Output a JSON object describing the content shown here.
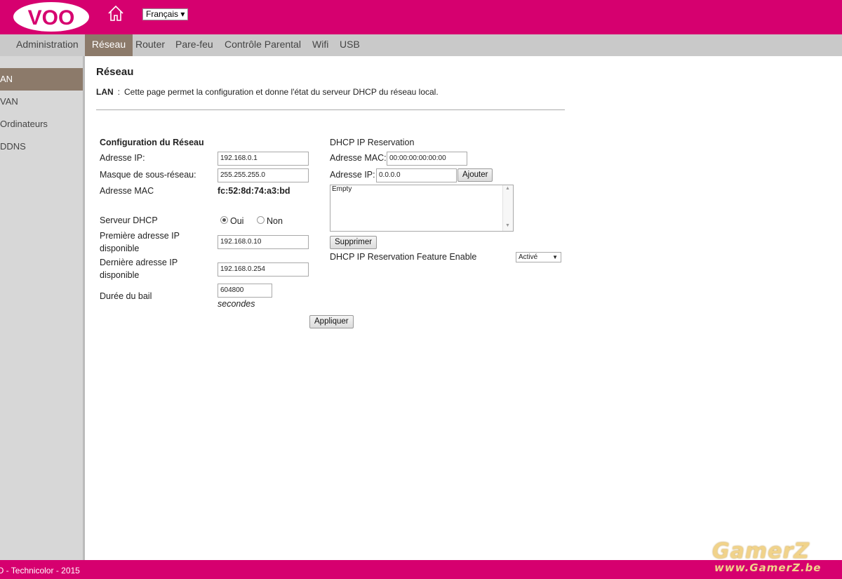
{
  "header": {
    "logo_text": "VOO",
    "home_icon": "home-icon",
    "language": "Français ▾"
  },
  "nav": {
    "items": [
      "Administration",
      "Réseau",
      "Router",
      "Pare-feu",
      "Contrôle Parental",
      "Wifi",
      "USB"
    ],
    "active": "Réseau"
  },
  "sidebar": {
    "items": [
      "LAN",
      "WAN",
      "Ordinateurs",
      "DDNS"
    ],
    "shown": [
      "AN",
      "VAN",
      "Ordinateurs",
      "DDNS"
    ],
    "active": "LAN"
  },
  "page": {
    "title": "Réseau",
    "desc_label": "LAN",
    "desc_sep": ":",
    "desc_text": "Cette page permet la configuration et donne l'état du serveur DHCP du réseau local."
  },
  "config": {
    "section_title": "Configuration du Réseau",
    "ip_label": "Adresse IP:",
    "ip_value": "192.168.0.1",
    "mask_label": "Masque de sous-réseau:",
    "mask_value": "255.255.255.0",
    "mac_label": "Adresse MAC",
    "mac_value": "fc:52:8d:74:a3:bd",
    "dhcp_label": "Serveur DHCP",
    "dhcp_oui": "Oui",
    "dhcp_non": "Non",
    "dhcp_selected": "Oui",
    "first_ip_label_1": "Première adresse IP",
    "first_ip_label_2": "disponible",
    "first_ip_value": "192.168.0.10",
    "last_ip_label_1": "Dernière adresse IP",
    "last_ip_label_2": "disponible",
    "last_ip_value": "192.168.0.254",
    "lease_label": "Durée du bail",
    "lease_value": "604800",
    "lease_unit": "secondes",
    "apply_button": "Appliquer"
  },
  "reservation": {
    "title": "DHCP IP Reservation",
    "mac_label": "Adresse MAC:",
    "mac_value": "00:00:00:00:00:00",
    "ip_label": "Adresse IP:",
    "ip_value": "0.0.0.0",
    "add_button": "Ajouter",
    "list_item": "Empty",
    "delete_button": "Supprimer",
    "feature_label": "DHCP IP Reservation Feature Enable",
    "feature_value": "Activé"
  },
  "footer": {
    "text": "O - Technicolor - 2015"
  },
  "watermark": {
    "text": "GamerZ",
    "url": "www.GamerZ.be"
  },
  "colors": {
    "brand": "#d6006f",
    "nav_active": "#8c7a6a",
    "nav_bg": "#c9c9c9",
    "sidebar_bg": "#d7d7d7"
  }
}
